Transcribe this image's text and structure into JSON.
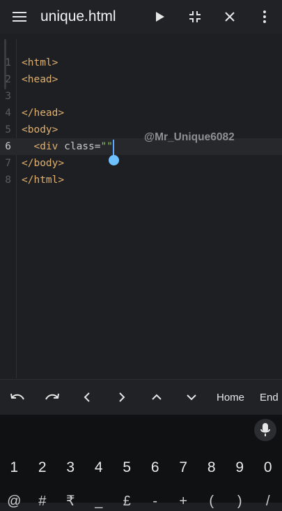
{
  "titlebar": {
    "menu_icon": "hamburger-menu-icon",
    "title": "unique.html",
    "actions": [
      "play-icon",
      "collapse-icon",
      "close-icon",
      "more-vertical-icon"
    ]
  },
  "editor": {
    "lines": [
      {
        "n": "1",
        "tokens": [
          {
            "t": "<html>",
            "c": "tag"
          }
        ]
      },
      {
        "n": "2",
        "tokens": [
          {
            "t": "<head>",
            "c": "tag"
          }
        ]
      },
      {
        "n": "3",
        "tokens": []
      },
      {
        "n": "4",
        "tokens": [
          {
            "t": "</head>",
            "c": "tag"
          }
        ]
      },
      {
        "n": "5",
        "tokens": [
          {
            "t": "<body>",
            "c": "tag"
          }
        ]
      },
      {
        "n": "6",
        "tokens": [
          {
            "t": "  <div ",
            "c": "tag"
          },
          {
            "t": "class=",
            "c": "attr"
          },
          {
            "t": "\"\"",
            "c": "str"
          }
        ],
        "active": true
      },
      {
        "n": "7",
        "tokens": [
          {
            "t": "</body>",
            "c": "tag"
          }
        ]
      },
      {
        "n": "8",
        "tokens": [
          {
            "t": "</html>",
            "c": "tag"
          }
        ]
      }
    ],
    "watermark": "@Mr_Unique6082"
  },
  "shortcuts": {
    "items": [
      "undo-icon",
      "redo-icon",
      "chevron-left-icon",
      "chevron-right-icon",
      "chevron-up-icon",
      "chevron-down-icon"
    ],
    "home_label": "Home",
    "end_label": "End"
  },
  "keyboard": {
    "mic_icon": "microphone-icon",
    "numbers": [
      "1",
      "2",
      "3",
      "4",
      "5",
      "6",
      "7",
      "8",
      "9",
      "0"
    ],
    "symbols": [
      "@",
      "#",
      "₹",
      "_",
      "£",
      "-",
      "+",
      "(",
      ")",
      "/"
    ]
  },
  "colors": {
    "background": "#1d1f22",
    "tag": "#e0b070",
    "string": "#8fbf6a",
    "caret": "#5aa8ff"
  }
}
